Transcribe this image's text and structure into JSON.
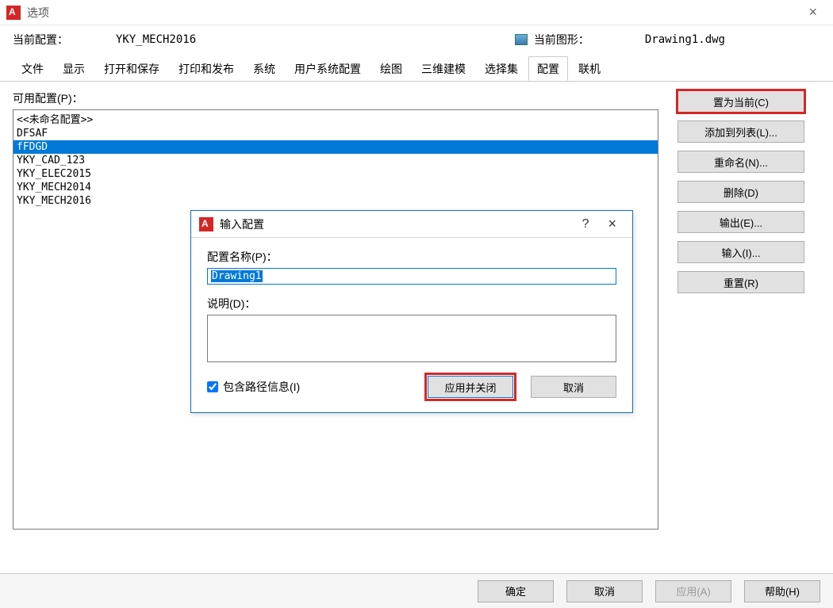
{
  "window": {
    "title": "选项",
    "close": "×"
  },
  "info": {
    "current_profile_label": "当前配置：",
    "current_profile_value": "YKY_MECH2016",
    "current_drawing_label": "当前图形：",
    "current_drawing_value": "Drawing1.dwg"
  },
  "tabs": [
    {
      "label": "文件"
    },
    {
      "label": "显示"
    },
    {
      "label": "打开和保存"
    },
    {
      "label": "打印和发布"
    },
    {
      "label": "系统"
    },
    {
      "label": "用户系统配置"
    },
    {
      "label": "绘图"
    },
    {
      "label": "三维建模"
    },
    {
      "label": "选择集"
    },
    {
      "label": "配置",
      "active": true
    },
    {
      "label": "联机"
    }
  ],
  "list_label": "可用配置(P)：",
  "profiles": [
    {
      "name": "<<未命名配置>>"
    },
    {
      "name": "DFSAF"
    },
    {
      "name": "fFDGD",
      "selected": true
    },
    {
      "name": "YKY_CAD_123"
    },
    {
      "name": "YKY_ELEC2015"
    },
    {
      "name": "YKY_MECH2014"
    },
    {
      "name": "YKY_MECH2016"
    }
  ],
  "sidebuttons": {
    "set_current": "置为当前(C)",
    "add_to_list": "添加到列表(L)...",
    "rename": "重命名(N)...",
    "delete": "删除(D)",
    "export": "输出(E)...",
    "import": "输入(I)...",
    "reset": "重置(R)"
  },
  "footer": {
    "ok": "确定",
    "cancel": "取消",
    "apply": "应用(A)",
    "help": "帮助(H)"
  },
  "modal": {
    "title": "输入配置",
    "help": "?",
    "close": "×",
    "name_label": "配置名称(P)：",
    "name_value": "Drawing1",
    "desc_label": "说明(D)：",
    "desc_value": "",
    "include_path": "包含路径信息(I)",
    "apply_close": "应用并关闭",
    "cancel": "取消"
  }
}
